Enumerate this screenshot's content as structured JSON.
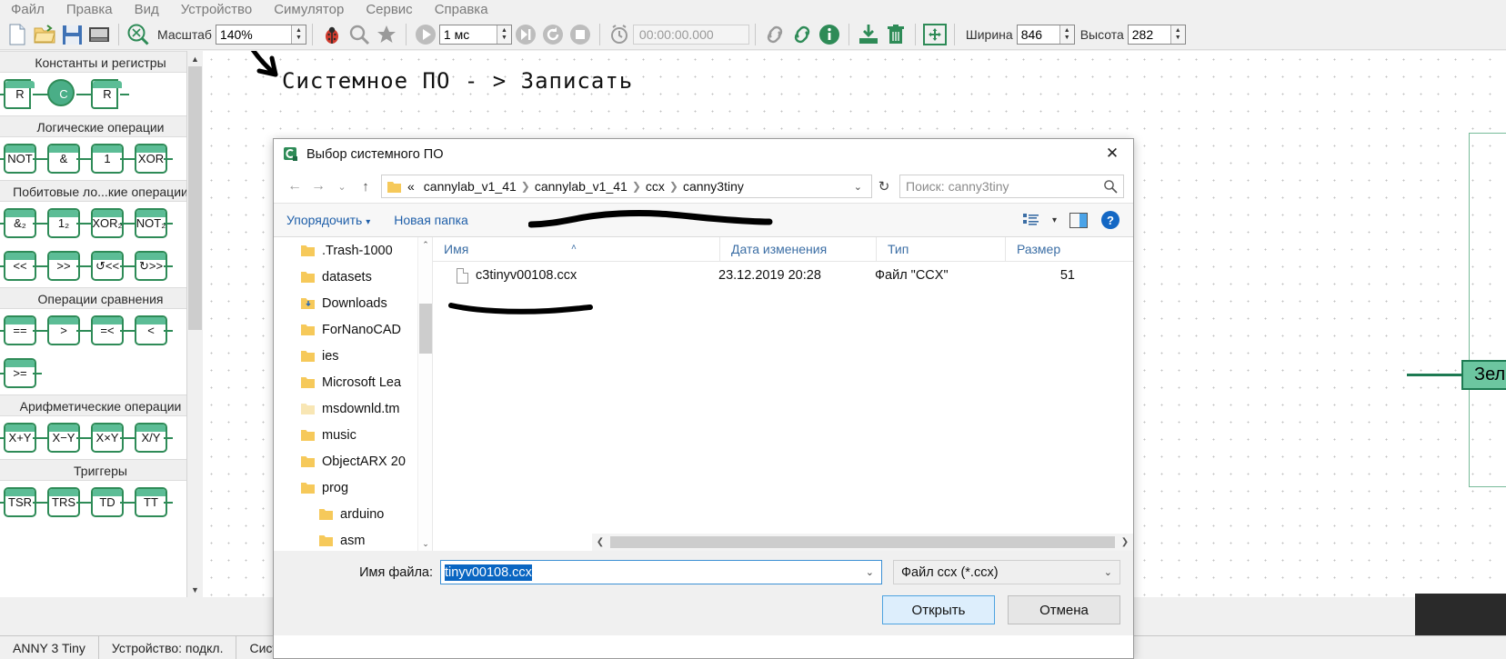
{
  "menubar": {
    "items": [
      {
        "label": "Файл"
      },
      {
        "label": "Правка"
      },
      {
        "label": "Вид"
      },
      {
        "label": "Устройство"
      },
      {
        "label": "Симулятор"
      },
      {
        "label": "Сервис"
      },
      {
        "label": "Справка"
      }
    ]
  },
  "toolbar": {
    "scale_label": "Масштаб",
    "scale_value": "140%",
    "sim_step_value": "1 мс",
    "time_value": "00:00:00.000",
    "width_label": "Ширина",
    "width_value": "846",
    "height_label": "Высота",
    "height_value": "282",
    "icons": {
      "new": "new-document-icon",
      "open": "open-folder-icon",
      "save": "save-icon",
      "screenshot": "screenshot-icon",
      "zoom_fit": "zoom-fit-icon",
      "debug": "debug-ladybug-icon",
      "find": "magnifier-icon",
      "favorite": "star-icon",
      "run": "run-icon",
      "step": "step-icon",
      "restart": "restart-icon",
      "stop": "stop-icon",
      "timer": "alarm-clock-icon",
      "link": "link-icon",
      "unlink": "broken-link-icon",
      "info": "info-icon",
      "download": "download-to-device-icon",
      "delete": "trash-icon",
      "resize": "resize-canvas-icon"
    }
  },
  "palette": {
    "groups": [
      {
        "title": "Константы и регистры",
        "blocks": [
          {
            "label": "R",
            "shape": "arrow"
          },
          {
            "label": "C",
            "shape": "round"
          },
          {
            "label": "R",
            "shape": "arrow"
          }
        ]
      },
      {
        "title": "Логические операции",
        "blocks": [
          {
            "label": "NOT",
            "shape": "box"
          },
          {
            "label": "&",
            "shape": "box"
          },
          {
            "label": "1",
            "shape": "box"
          },
          {
            "label": "XOR",
            "shape": "box"
          }
        ]
      },
      {
        "title": "Побитовые ло...кие операции",
        "blocks": [
          {
            "label": "&₂",
            "shape": "box"
          },
          {
            "label": "1₂",
            "shape": "box"
          },
          {
            "label": "XOR₂",
            "shape": "box"
          },
          {
            "label": "NOT₂",
            "shape": "box"
          }
        ]
      },
      {
        "title": "",
        "blocks": [
          {
            "label": "<<",
            "shape": "box"
          },
          {
            "label": ">>",
            "shape": "box"
          },
          {
            "label": "↺<<",
            "shape": "box"
          },
          {
            "label": "↻>>",
            "shape": "box"
          }
        ]
      },
      {
        "title": "Операции сравнения",
        "blocks": [
          {
            "label": "==",
            "shape": "box"
          },
          {
            "label": ">",
            "shape": "box"
          },
          {
            "label": "=<",
            "shape": "box"
          },
          {
            "label": "<",
            "shape": "box"
          }
        ]
      },
      {
        "title": "",
        "blocks": [
          {
            "label": ">=",
            "shape": "box"
          }
        ]
      },
      {
        "title": "Арифметические операции",
        "blocks": [
          {
            "label": "X+Y",
            "shape": "box"
          },
          {
            "label": "X−Y",
            "shape": "box"
          },
          {
            "label": "X×Y",
            "shape": "box"
          },
          {
            "label": "X/Y",
            "shape": "box"
          }
        ]
      },
      {
        "title": "Триггеры",
        "blocks": [
          {
            "label": "TSR",
            "shape": "box"
          },
          {
            "label": "TRS",
            "shape": "box"
          },
          {
            "label": "TD",
            "shape": "box"
          },
          {
            "label": "TT",
            "shape": "box"
          }
        ]
      }
    ]
  },
  "canvas": {
    "title": "Системное ПО - > Записать",
    "led_label": "Зеленый светодиод"
  },
  "statusbar": {
    "cells": [
      "ANNY 3 Tiny",
      "Устройство: подкл.",
      "Систем"
    ]
  },
  "dialog": {
    "title": "Выбор системного ПО",
    "close_icon": "close-icon",
    "nav": {
      "back_icon": "arrow-left-icon",
      "forward_icon": "arrow-right-icon",
      "recent_icon": "chevron-down-icon",
      "up_icon": "arrow-up-icon",
      "folder_icon": "folder-icon",
      "breadcrumb_prefix": "«",
      "breadcrumbs": [
        "cannylab_v1_41",
        "cannylab_v1_41",
        "ccx",
        "canny3tiny"
      ],
      "dropdown_icon": "chevron-down-icon",
      "refresh_icon": "refresh-icon"
    },
    "search": {
      "placeholder": "Поиск: canny3tiny",
      "icon": "search-icon"
    },
    "commandbar": {
      "organize_label": "Упорядочить",
      "organize_icon": "chevron-down-icon",
      "new_folder_label": "Новая папка",
      "view_icon": "list-view-icon",
      "view_dropdown_icon": "chevron-down-icon",
      "preview_pane_icon": "preview-pane-icon",
      "help_icon": "help-icon"
    },
    "tree": {
      "items": [
        {
          "label": ".Trash-1000",
          "indent": 0,
          "icon": "folder-icon"
        },
        {
          "label": "datasets",
          "indent": 0,
          "icon": "folder-icon"
        },
        {
          "label": "Downloads",
          "indent": 0,
          "icon": "folder-download-icon"
        },
        {
          "label": "ForNanoCAD",
          "indent": 0,
          "icon": "folder-icon"
        },
        {
          "label": "ies",
          "indent": 0,
          "icon": "folder-icon"
        },
        {
          "label": "Microsoft Lea",
          "indent": 0,
          "icon": "folder-icon"
        },
        {
          "label": "msdownld.tm",
          "indent": 0,
          "icon": "folder-icon"
        },
        {
          "label": "music",
          "indent": 0,
          "icon": "folder-icon"
        },
        {
          "label": "ObjectARX 20",
          "indent": 0,
          "icon": "folder-icon"
        },
        {
          "label": "prog",
          "indent": 0,
          "icon": "folder-icon"
        },
        {
          "label": "arduino",
          "indent": 1,
          "icon": "folder-icon"
        },
        {
          "label": "asm",
          "indent": 1,
          "icon": "folder-icon"
        }
      ]
    },
    "filelist": {
      "columns": [
        "Имя",
        "Дата изменения",
        "Тип",
        "Размер"
      ],
      "sort_indicator": "˄",
      "rows": [
        {
          "name": "c3tinyv00108.ccx",
          "date": "23.12.2019 20:28",
          "type": "Файл \"CCX\"",
          "size": "51",
          "icon": "file-icon"
        }
      ]
    },
    "footer": {
      "filename_label": "Имя файла:",
      "filename_value": "tinyv00108.ccx",
      "filename_dropdown_icon": "chevron-down-icon",
      "filter_value": "Файл ccx (*.ccx)",
      "filter_dropdown_icon": "chevron-down-icon",
      "open_label": "Открыть",
      "cancel_label": "Отмена"
    }
  },
  "colors": {
    "accent_green": "#2e8b57",
    "block_fill": "#6cc6a0",
    "link_blue": "#1f5fa9",
    "selection_blue": "#0a66c2",
    "ink_black": "#000000"
  }
}
